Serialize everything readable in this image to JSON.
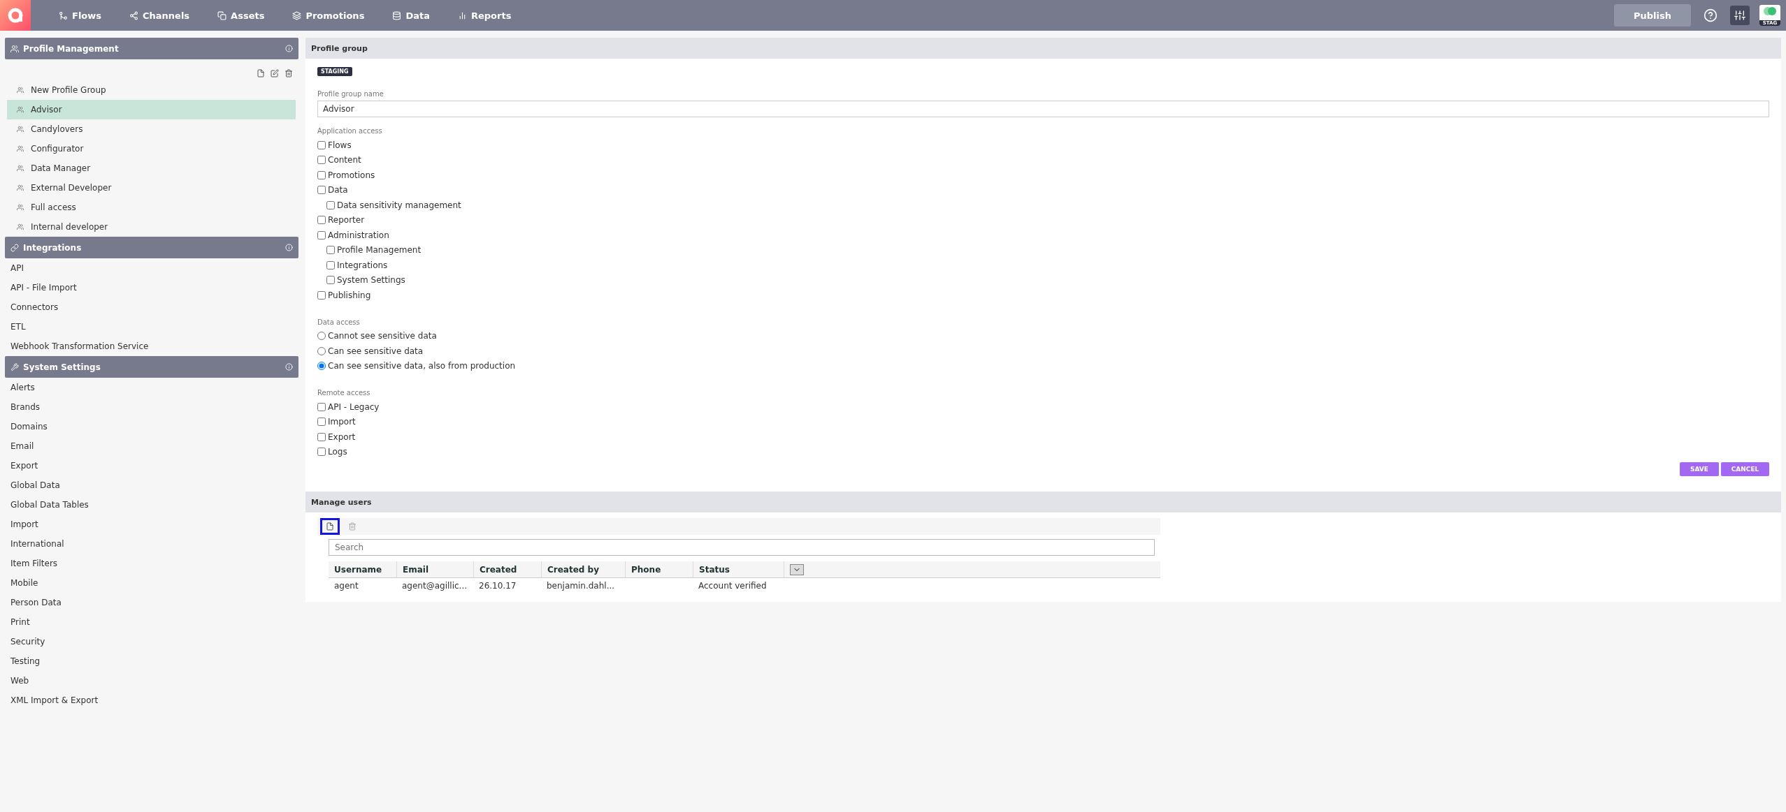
{
  "nav": {
    "items": [
      {
        "label": "Flows"
      },
      {
        "label": "Channels"
      },
      {
        "label": "Assets"
      },
      {
        "label": "Promotions"
      },
      {
        "label": "Data"
      },
      {
        "label": "Reports"
      }
    ],
    "publish": "Publish",
    "env_badge": "STAG"
  },
  "sidebar": {
    "sections": [
      {
        "title": "Profile Management",
        "items": [
          {
            "label": "New Profile Group",
            "selected": false
          },
          {
            "label": "Advisor",
            "selected": true
          },
          {
            "label": "Candylovers",
            "selected": false
          },
          {
            "label": "Configurator",
            "selected": false
          },
          {
            "label": "Data Manager",
            "selected": false
          },
          {
            "label": "External Developer",
            "selected": false
          },
          {
            "label": "Full access",
            "selected": false
          },
          {
            "label": "Internal developer",
            "selected": false
          }
        ]
      },
      {
        "title": "Integrations",
        "items": [
          {
            "label": "API",
            "selected": false
          },
          {
            "label": "API - File Import",
            "selected": false
          },
          {
            "label": "Connectors",
            "selected": false
          },
          {
            "label": "ETL",
            "selected": false
          },
          {
            "label": "Webhook Transformation Service",
            "selected": false
          }
        ]
      },
      {
        "title": "System Settings",
        "items": [
          {
            "label": "Alerts",
            "selected": false
          },
          {
            "label": "Brands",
            "selected": false
          },
          {
            "label": "Domains",
            "selected": false
          },
          {
            "label": "Email",
            "selected": false
          },
          {
            "label": "Export",
            "selected": false
          },
          {
            "label": "Global Data",
            "selected": false
          },
          {
            "label": "Global Data Tables",
            "selected": false
          },
          {
            "label": "Import",
            "selected": false
          },
          {
            "label": "International",
            "selected": false
          },
          {
            "label": "Item Filters",
            "selected": false
          },
          {
            "label": "Mobile",
            "selected": false
          },
          {
            "label": "Person Data",
            "selected": false
          },
          {
            "label": "Print",
            "selected": false
          },
          {
            "label": "Security",
            "selected": false
          },
          {
            "label": "Testing",
            "selected": false
          },
          {
            "label": "Web",
            "selected": false
          },
          {
            "label": "XML Import & Export",
            "selected": false
          }
        ]
      }
    ]
  },
  "profile_group": {
    "title": "Profile group",
    "badge": "STAGING",
    "name_label": "Profile group name",
    "name_value": "Advisor",
    "application_access": {
      "label": "Application access",
      "options": [
        {
          "label": "Flows",
          "checked": false
        },
        {
          "label": "Content",
          "checked": false
        },
        {
          "label": "Promotions",
          "checked": false
        },
        {
          "label": "Data",
          "checked": false,
          "children": [
            {
              "label": "Data sensitivity management",
              "checked": false
            }
          ]
        },
        {
          "label": "Reporter",
          "checked": false
        },
        {
          "label": "Administration",
          "checked": false,
          "children": [
            {
              "label": "Profile Management",
              "checked": false
            },
            {
              "label": "Integrations",
              "checked": false
            },
            {
              "label": "System Settings",
              "checked": false
            }
          ]
        },
        {
          "label": "Publishing",
          "checked": false
        }
      ]
    },
    "data_access": {
      "label": "Data access",
      "options": [
        {
          "label": "Cannot see sensitive data",
          "selected": false
        },
        {
          "label": "Can see sensitive data",
          "selected": false
        },
        {
          "label": "Can see sensitive data, also from production",
          "selected": true
        }
      ]
    },
    "remote_access": {
      "label": "Remote access",
      "options": [
        {
          "label": "API - Legacy",
          "checked": false
        },
        {
          "label": "Import",
          "checked": false
        },
        {
          "label": "Export",
          "checked": false
        },
        {
          "label": "Logs",
          "checked": false
        }
      ]
    },
    "buttons": [
      "SAVE",
      "CANCEL"
    ]
  },
  "manage_users": {
    "title": "Manage users",
    "new_focused": true,
    "search_placeholder": "Search",
    "columns": [
      "Username",
      "Email",
      "Created",
      "Created by",
      "Phone",
      "Status"
    ],
    "rows": [
      [
        "agent",
        "agent@agillic...",
        "26.10.17",
        "benjamin.dahl...",
        "",
        "Account verified"
      ]
    ]
  }
}
